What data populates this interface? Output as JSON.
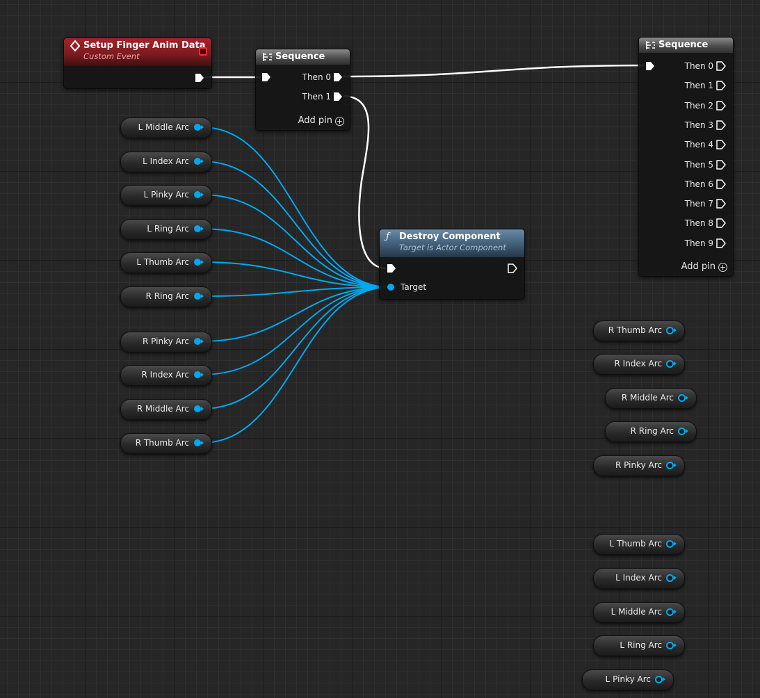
{
  "colors": {
    "exec_wire": "#ffffff",
    "object_wire": "#00a8f2",
    "event_header": "#a6232a",
    "function_header": "#3c5972",
    "sequence_header": "#6e6e6e"
  },
  "event_node": {
    "title": "Setup Finger Anim Data",
    "subtitle": "Custom Event",
    "icon": "diamond-event-icon"
  },
  "sequence_1": {
    "title": "Sequence",
    "icon": "sequence-icon",
    "outputs": [
      "Then 0",
      "Then 1"
    ],
    "add_pin": "Add pin"
  },
  "sequence_2": {
    "title": "Sequence",
    "icon": "sequence-icon",
    "outputs": [
      "Then 0",
      "Then 1",
      "Then 2",
      "Then 3",
      "Then 4",
      "Then 5",
      "Then 6",
      "Then 7",
      "Then 8",
      "Then 9"
    ],
    "add_pin": "Add pin"
  },
  "destroy_node": {
    "title": "Destroy Component",
    "subtitle": "Target is Actor Component",
    "icon": "function-icon",
    "target_label": "Target"
  },
  "left_variables": [
    "L Middle Arc",
    "L Index Arc",
    "L Pinky Arc",
    "L Ring Arc",
    "L Thumb Arc",
    "R Ring Arc",
    "R Pinky Arc",
    "R Index Arc",
    "R Middle Arc",
    "R Thumb Arc"
  ],
  "right_variables_r": [
    "R Thumb Arc",
    "R Index Arc",
    "R Middle Arc",
    "R Ring Arc",
    "R Pinky Arc"
  ],
  "right_variables_l": [
    "L Thumb Arc",
    "L Index Arc",
    "L Middle Arc",
    "L Ring Arc",
    "L Pinky Arc"
  ]
}
